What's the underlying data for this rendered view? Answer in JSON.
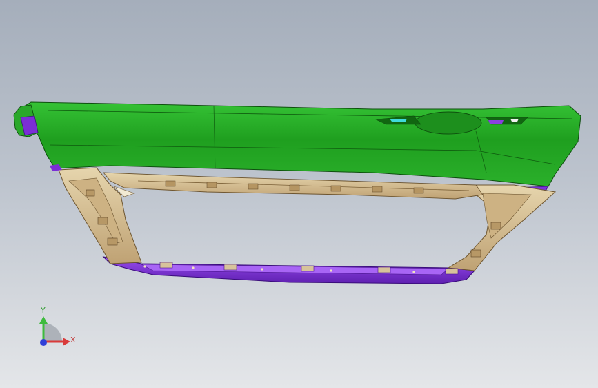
{
  "viewport": {
    "background_top": "#a5aebb",
    "background_bottom": "#e4e6e9"
  },
  "model": {
    "parts": [
      {
        "name": "outer-skin",
        "color": "#22a522"
      },
      {
        "name": "inner-panel",
        "color": "#d8c39a"
      },
      {
        "name": "lower-frame",
        "color": "#7b2ed6"
      }
    ]
  },
  "triad": {
    "x_label": "X",
    "y_label": "Y",
    "x_color": "#d93b3b",
    "y_color": "#3dbb3d",
    "z_color": "#2f3fd8"
  }
}
